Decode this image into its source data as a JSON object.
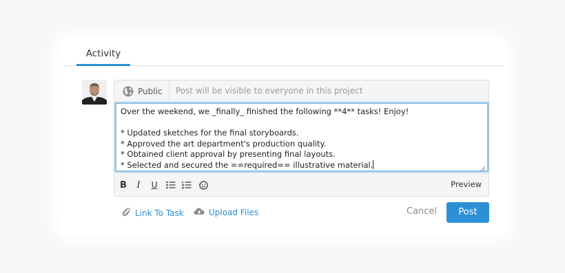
{
  "tabs": [
    {
      "label": "Activity",
      "active": true
    }
  ],
  "composer": {
    "visibility_label": "Public",
    "visibility_hint": "Post will be visible to everyone in this project",
    "editor_lines": [
      "Over the weekend, we _finally_ finished the following **4** tasks! Enjoy!",
      "",
      "* Updated sketches for the final storyboards.",
      "* Approved the art department's production quality.",
      "* Obtained client approval by presenting final layouts.",
      "* Selected and secured the ==required== illustrative material."
    ],
    "toolbar": {
      "tools": [
        "bold-icon",
        "italic-icon",
        "underline-icon",
        "bullet-list-icon",
        "numbered-list-icon",
        "emoji-icon"
      ],
      "bold_glyph": "B",
      "italic_glyph": "I",
      "underline_glyph": "U",
      "preview_label": "Preview"
    }
  },
  "actions": {
    "link_task_label": "Link To Task",
    "upload_files_label": "Upload Files",
    "cancel_label": "Cancel",
    "post_label": "Post"
  },
  "colors": {
    "accent": "#2d8fd5",
    "focus_border": "#8ac0e8",
    "muted_text": "#9a9a9a"
  }
}
